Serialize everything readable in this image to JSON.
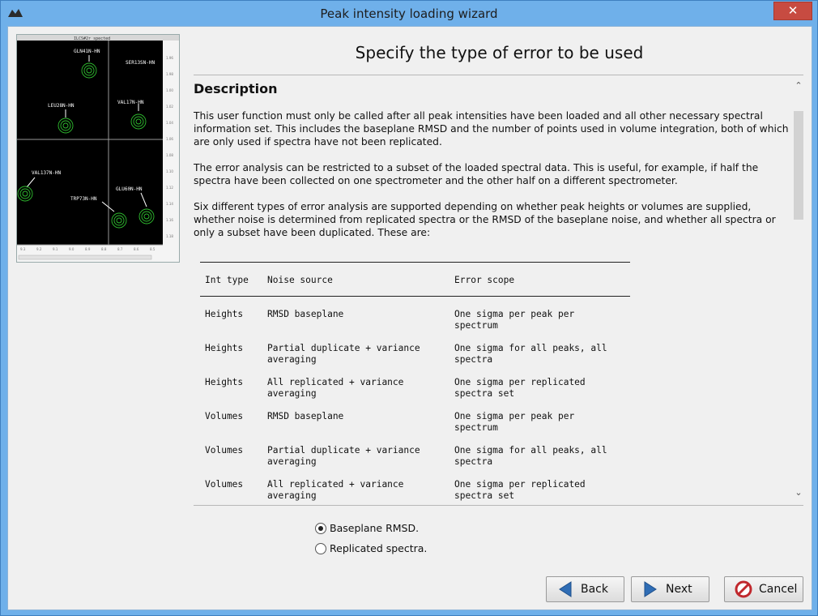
{
  "window": {
    "title": "Peak intensity loading wizard",
    "close_glyph": "✕"
  },
  "page": {
    "heading": "Specify the type of error to be used"
  },
  "spectrum_image": {
    "title": "ILCS#2r_spected",
    "peaks": [
      {
        "label": "GLN41N-HN"
      },
      {
        "label": "SER13SN-HN"
      },
      {
        "label": "LEU28N-HN"
      },
      {
        "label": "VAL17N-HN"
      },
      {
        "label": "VAL137N-HN"
      },
      {
        "label": "TRP73N-HN"
      },
      {
        "label": "GLU60N-HN"
      }
    ]
  },
  "description": {
    "title": "Description",
    "paragraphs": [
      "This user function must only be called after all peak intensities have been loaded and all other necessary spectral information set.  This includes the baseplane RMSD and the number of points used in volume integration, both of which are only used if spectra have not been replicated.",
      "The error analysis can be restricted to a subset of the loaded spectral data.  This is useful, for example, if half the spectra have been collected on one spectrometer and the other half on a different spectrometer.",
      "Six different types of error analysis are supported depending on whether peak heights or volumes are supplied, whether noise is determined from replicated spectra or the RMSD of the baseplane noise, and whether all spectra or only a subset have been duplicated.  These are:"
    ],
    "table": {
      "headers": [
        "Int type",
        "Noise source",
        "Error scope"
      ],
      "rows": [
        [
          "Heights",
          "RMSD baseplane",
          "One sigma per peak per\nspectrum"
        ],
        [
          "Heights",
          "Partial duplicate + variance\naveraging",
          "One sigma for all peaks, all\nspectra"
        ],
        [
          "Heights",
          "All replicated + variance\naveraging",
          "One sigma per replicated\nspectra set"
        ],
        [
          "Volumes",
          "RMSD baseplane",
          "One sigma per peak per\nspectrum"
        ],
        [
          "Volumes",
          "Partial duplicate + variance\naveraging",
          "One sigma for all peaks, all\nspectra"
        ],
        [
          "Volumes",
          "All replicated + variance\naveraging",
          "One sigma per replicated\nspectra set"
        ]
      ]
    }
  },
  "options": [
    {
      "label": "Baseplane RMSD.",
      "checked": true
    },
    {
      "label": "Replicated spectra.",
      "checked": false
    }
  ],
  "buttons": {
    "back": "Back",
    "next": "Next",
    "cancel": "Cancel"
  },
  "icons": {
    "back": "left-arrow-icon",
    "next": "right-arrow-icon",
    "cancel": "cancel-icon"
  },
  "colors": {
    "arrow_blue": "#2f6db5",
    "cancel_red": "#c0282d",
    "peak_green": "#2fbf2f"
  }
}
